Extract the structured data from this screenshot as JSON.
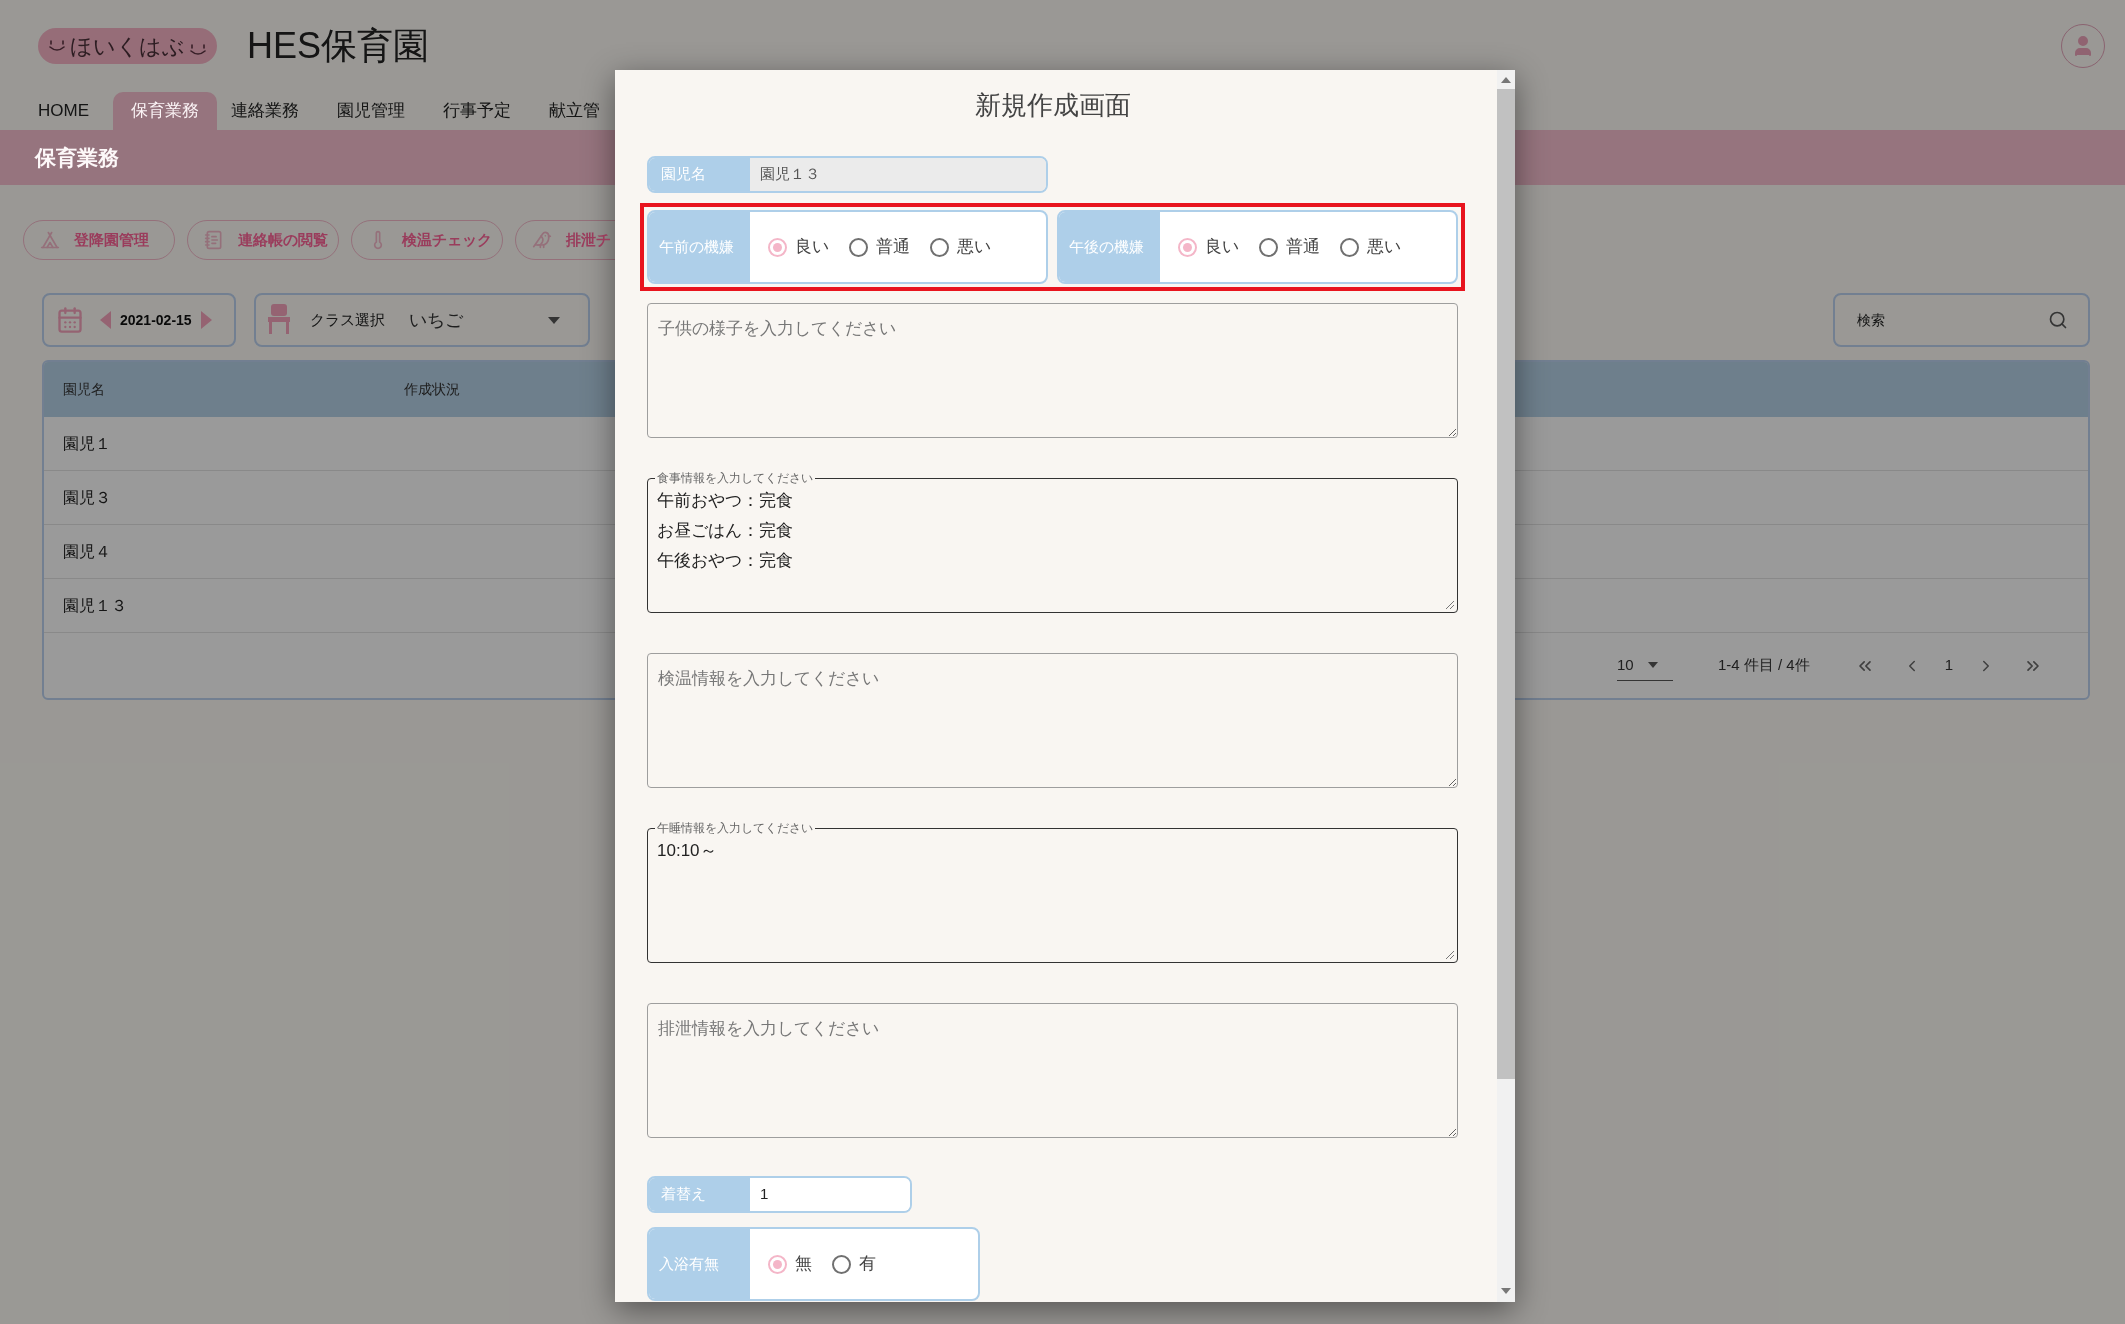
{
  "app": {
    "logo": "ほいくはぶ",
    "title": "HES保育園"
  },
  "nav_tabs": [
    {
      "label": "HOME",
      "selected": false
    },
    {
      "label": "保育業務",
      "selected": true
    },
    {
      "label": "連絡業務",
      "selected": false
    },
    {
      "label": "園児管理",
      "selected": false
    },
    {
      "label": "行事予定",
      "selected": false
    },
    {
      "label": "献立管",
      "selected": false
    }
  ],
  "section_title": "保育業務",
  "shortcuts": [
    {
      "label": "登降園管理"
    },
    {
      "label": "連絡帳の閲覧"
    },
    {
      "label": "検温チェック"
    },
    {
      "label": "排泄チ"
    }
  ],
  "date_picker": {
    "value": "2021-02-15"
  },
  "class_select": {
    "label": "クラス選択",
    "value": "いちご"
  },
  "search": {
    "placeholder": "検索"
  },
  "table": {
    "columns": [
      "園児名",
      "作成状況"
    ],
    "rows": [
      {
        "name": "園児１"
      },
      {
        "name": "園児３"
      },
      {
        "name": "園児４"
      },
      {
        "name": "園児１３"
      }
    ]
  },
  "pagination": {
    "page_size": "10",
    "range": "1-4 件目 / 4件",
    "page": "1"
  },
  "modal": {
    "title": "新規作成画面",
    "child_name": {
      "label": "園児名",
      "value": "園児１３"
    },
    "moods_highlighted": true,
    "moods": [
      {
        "label": "午前の機嫌",
        "options": [
          {
            "label": "良い",
            "selected": true
          },
          {
            "label": "普通",
            "selected": false
          },
          {
            "label": "悪い",
            "selected": false
          }
        ]
      },
      {
        "label": "午後の機嫌",
        "options": [
          {
            "label": "良い",
            "selected": true
          },
          {
            "label": "普通",
            "selected": false
          },
          {
            "label": "悪い",
            "selected": false
          }
        ]
      }
    ],
    "notes": [
      {
        "placeholder": "子供の様子を入力してください"
      },
      {
        "label": "食事情報を入力してください",
        "lines": [
          "午前おやつ：完食",
          "お昼ごはん：完食",
          "午後おやつ：完食"
        ]
      },
      {
        "placeholder": "検温情報を入力してください"
      },
      {
        "label": "午睡情報を入力してください",
        "lines": [
          "10:10～"
        ]
      },
      {
        "placeholder": "排泄情報を入力してください"
      }
    ],
    "change_clothes": {
      "label": "着替え",
      "value": "1"
    },
    "bath": {
      "label": "入浴有無",
      "options": [
        {
          "label": "無",
          "selected": true
        },
        {
          "label": "有",
          "selected": false
        }
      ]
    }
  }
}
